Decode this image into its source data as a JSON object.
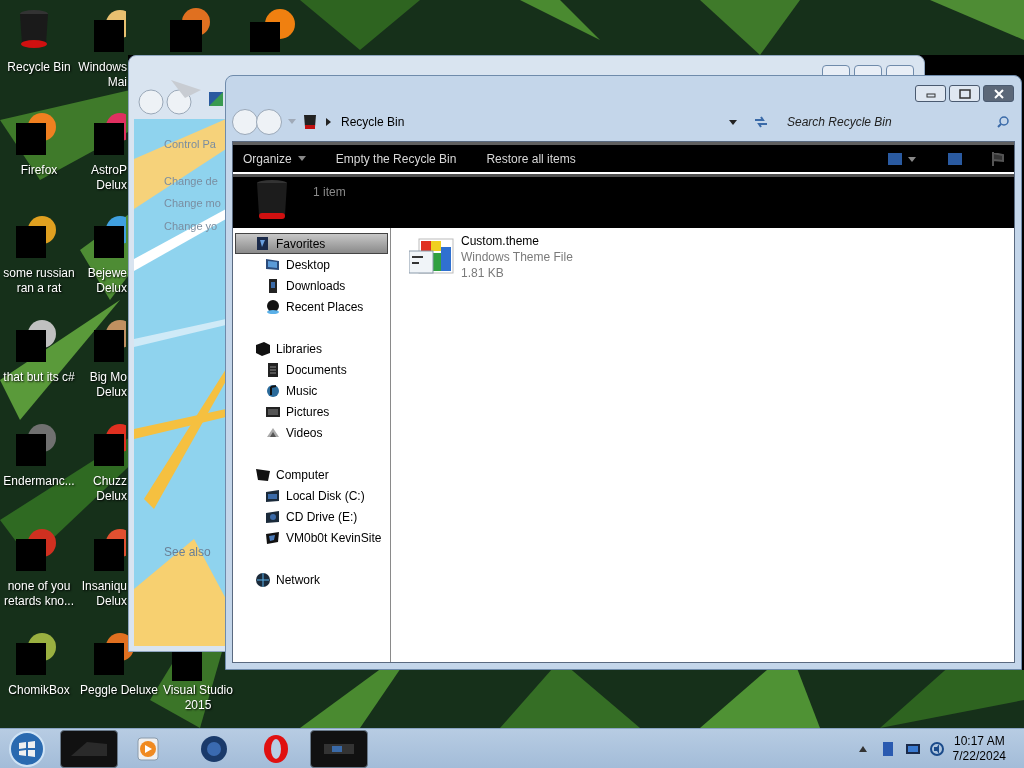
{
  "desktop_icons": [
    {
      "label": "Recycle Bin"
    },
    {
      "label": "Firefox"
    },
    {
      "label": "some russian\nran a rat"
    },
    {
      "label": "that but its c#"
    },
    {
      "label": "Endermanc..."
    },
    {
      "label": "none of you\nretards kno..."
    },
    {
      "label": "ChomikBox"
    },
    {
      "label": "Windows\nMai"
    },
    {
      "label": "AstroP\nDelux"
    },
    {
      "label": "Bejewe\nDelux"
    },
    {
      "label": "Big Mo\nDelux"
    },
    {
      "label": "Chuzz\nDelux"
    },
    {
      "label": "Insaniqu\nDelux"
    },
    {
      "label": "Peggle Deluxe"
    },
    {
      "label": "Visual Studio\n2015"
    }
  ],
  "back_window": {
    "nav_links": [
      "Control Pa",
      "Change de",
      "Change mo",
      "Change yo"
    ],
    "see_also": "See also"
  },
  "explorer": {
    "breadcrumb": "Recycle Bin",
    "search": {
      "placeholder": "Search Recycle Bin"
    },
    "commands": [
      {
        "label": "Organize",
        "dropdown": true
      },
      {
        "label": "Empty the Recycle Bin",
        "dropdown": false
      },
      {
        "label": "Restore all items",
        "dropdown": false
      }
    ],
    "details": "1 item",
    "nav": [
      {
        "label": "Favorites",
        "selected": true,
        "children": [
          {
            "label": "Desktop",
            "selected": false
          },
          {
            "label": "Downloads",
            "selected": false
          },
          {
            "label": "Recent Places",
            "selected": false
          }
        ]
      },
      {
        "label": "Libraries",
        "selected": false,
        "children": [
          {
            "label": "Documents",
            "selected": false
          },
          {
            "label": "Music",
            "selected": false
          },
          {
            "label": "Pictures",
            "selected": false
          },
          {
            "label": "Videos",
            "selected": false
          }
        ]
      },
      {
        "label": "Computer",
        "selected": false,
        "children": [
          {
            "label": "Local Disk (C:)",
            "selected": false
          },
          {
            "label": "CD Drive (E:)",
            "selected": false
          },
          {
            "label": "VM0b0t KevinSite",
            "selected": false
          }
        ]
      },
      {
        "label": "Network",
        "selected": false
      }
    ],
    "files": [
      {
        "name": "Custom.theme",
        "type": "Windows Theme File",
        "size": "1.81 KB"
      }
    ]
  },
  "taskbar": {
    "buttons": [
      {
        "active": true
      },
      {
        "active": false
      },
      {
        "active": false
      },
      {
        "active": false
      },
      {
        "active": true
      }
    ],
    "time": "10:17 AM",
    "date": "7/22/2024"
  }
}
